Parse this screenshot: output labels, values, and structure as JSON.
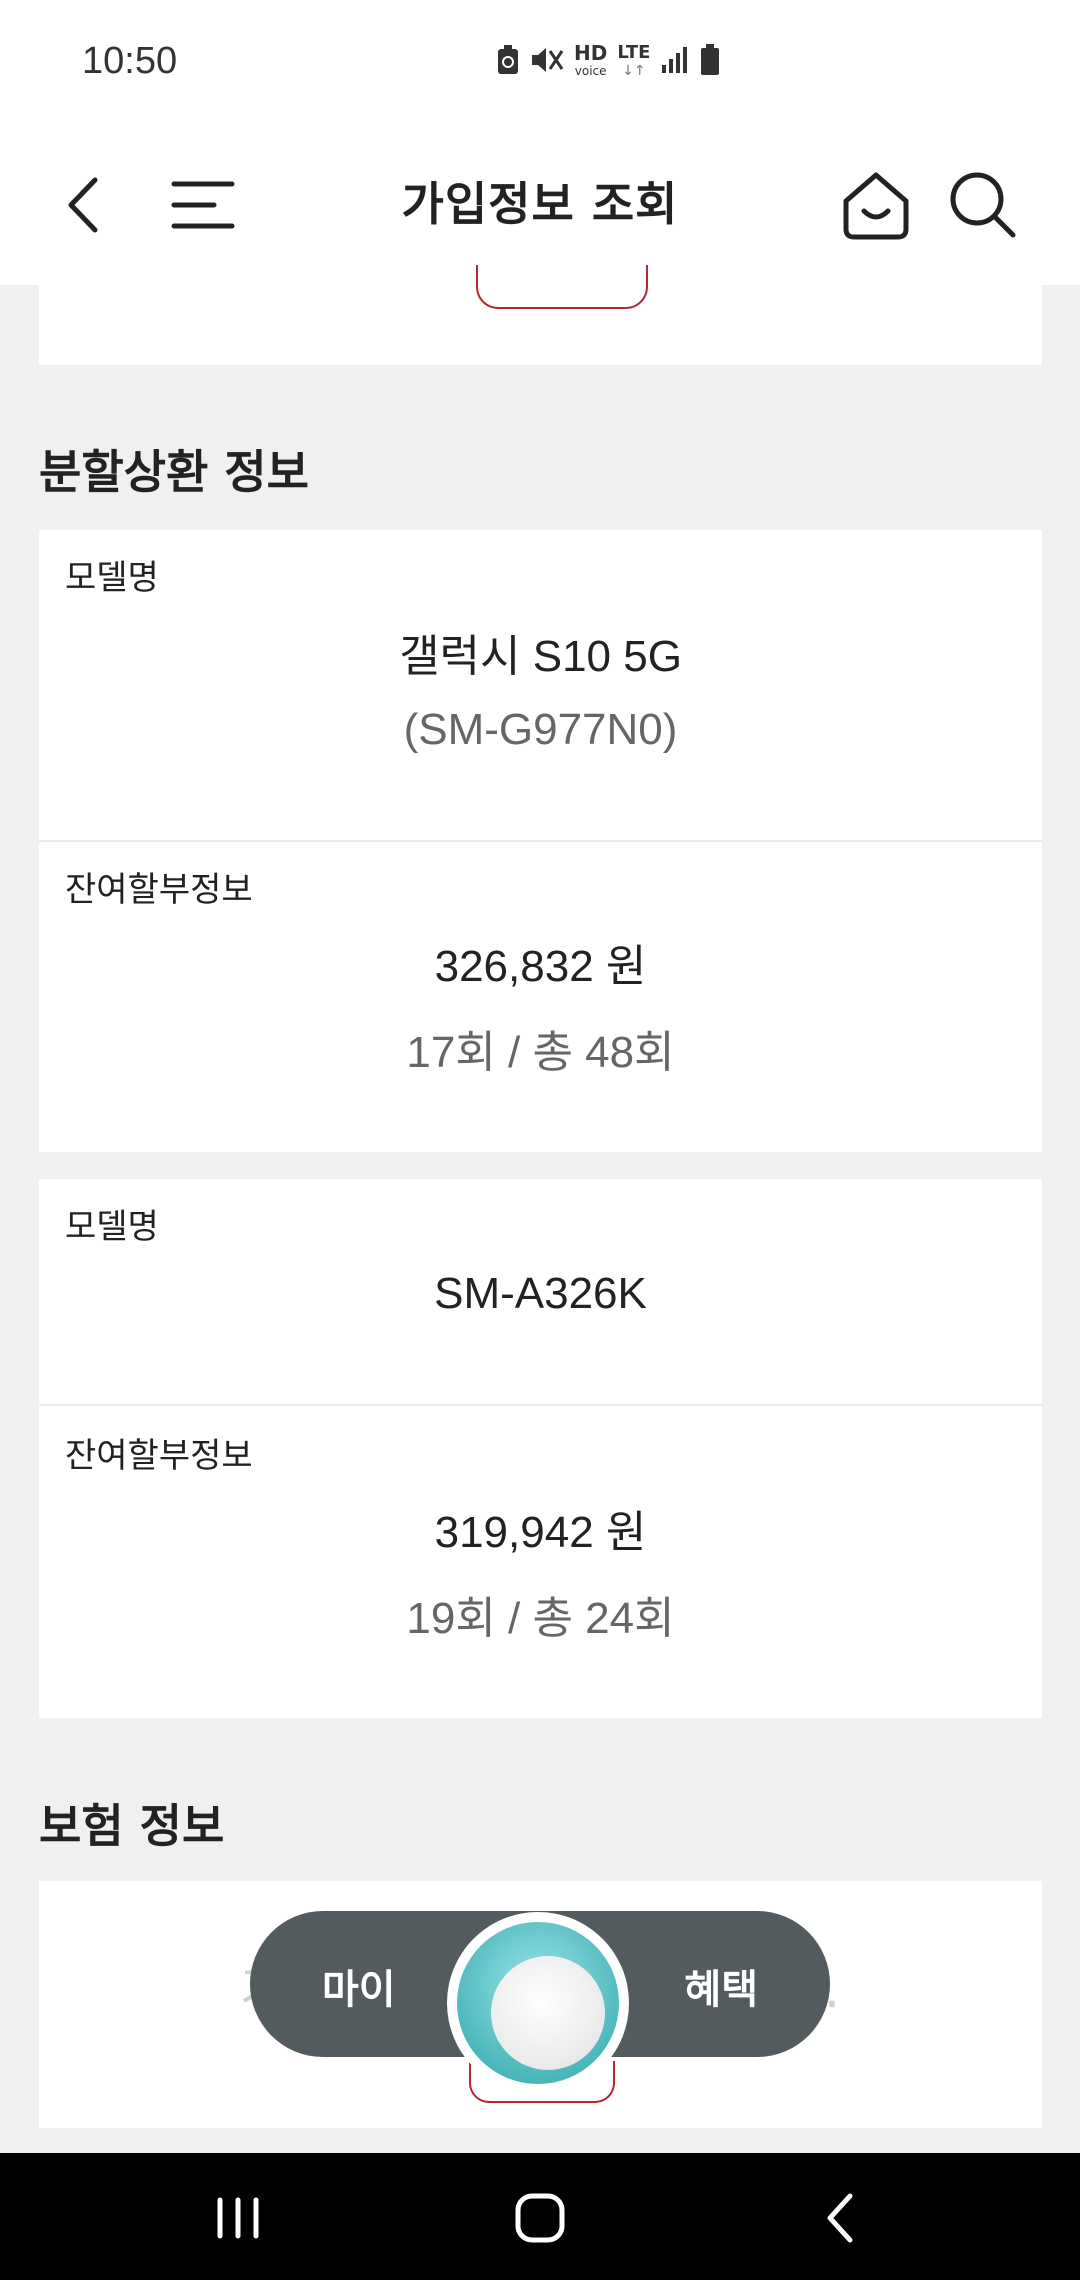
{
  "status": {
    "time": "10:50",
    "hd_label": "HD",
    "hd_sub": "voice",
    "lte_label": "LTE"
  },
  "header": {
    "title": "가입정보 조회"
  },
  "installment": {
    "section_title": "분할상환 정보",
    "devices": [
      {
        "model_label": "모델명",
        "model_name": "갤럭시 S10 5G",
        "model_code": "(SM-G977N0)",
        "balance_label": "잔여할부정보",
        "balance": "326,832 원",
        "progress": "17회 / 총 48회"
      },
      {
        "model_label": "모델명",
        "model_name": "SM-A326K",
        "balance_label": "잔여할부정보",
        "balance": "319,942 원",
        "progress": "19회 / 총 24회"
      }
    ]
  },
  "insurance": {
    "section_title": "보험 정보",
    "empty_text": "가입된 단말보험이 없습니다."
  },
  "floating_nav": {
    "left_label": "마이",
    "right_label": "혜택"
  }
}
